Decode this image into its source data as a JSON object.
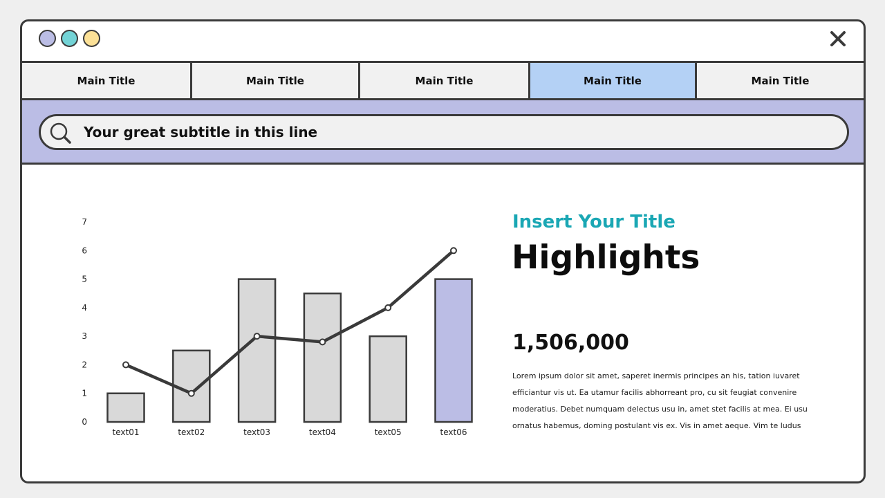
{
  "window": {
    "dots": [
      {
        "name": "purple",
        "color": "#bbbde5"
      },
      {
        "name": "teal",
        "color": "#73d3d6"
      },
      {
        "name": "yellow",
        "color": "#fce197"
      }
    ]
  },
  "tabs": [
    {
      "label": "Main Title",
      "active": false
    },
    {
      "label": "Main Title",
      "active": false
    },
    {
      "label": "Main Title",
      "active": false
    },
    {
      "label": "Main Title",
      "active": true
    },
    {
      "label": "Main Title",
      "active": false
    }
  ],
  "search": {
    "text": "Your great subtitle in this line"
  },
  "colors": {
    "band": "#bbbde5",
    "active_tab": "#b4d1f5",
    "accent": "#1aa7b4",
    "bar_gray": "#d9d9d9",
    "bar_highlight": "#bbbde5",
    "line": "#3a3a3a"
  },
  "panel": {
    "kicker": "Insert Your Title",
    "headline": "Highlights",
    "number": "1,506,000",
    "body": "Lorem ipsum dolor sit amet, saperet inermis principes an his, tation iuvaret efficiantur vis ut. Ea utamur facilis abhorreant pro, cu sit feugiat convenire moderatius. Debet numquam delectus usu in, amet stet facilis at mea. Ei usu ornatus habemus, doming postulant vis ex. Vis in amet aeque. Vim te ludus"
  },
  "chart_data": {
    "type": "bar",
    "categories": [
      "text01",
      "text02",
      "text03",
      "text04",
      "text05",
      "text06"
    ],
    "series": [
      {
        "type": "bar",
        "values": [
          1,
          2.5,
          5,
          4.5,
          3,
          5
        ]
      },
      {
        "type": "line",
        "values": [
          2,
          1,
          3,
          2.8,
          4,
          6
        ]
      }
    ],
    "highlight_index": 5,
    "ylim": [
      0,
      7
    ],
    "yticks": [
      0,
      1,
      2,
      3,
      4,
      5,
      6,
      7
    ],
    "grid": false,
    "legend": "none"
  }
}
